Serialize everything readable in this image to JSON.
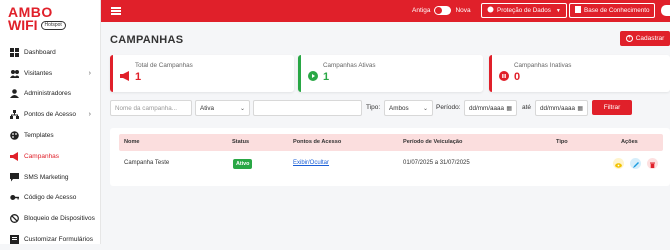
{
  "brand": {
    "line1": "AMBO",
    "line2": "WIFI",
    "badge": "Hotspot"
  },
  "sidebar": {
    "items": [
      {
        "label": "Dashboard",
        "icon": "grid-icon",
        "chevron": false,
        "active": false
      },
      {
        "label": "Visitantes",
        "icon": "users-icon",
        "chevron": true,
        "active": false
      },
      {
        "label": "Administradores",
        "icon": "user-icon",
        "chevron": false,
        "active": false
      },
      {
        "label": "Pontos de Acesso",
        "icon": "network-icon",
        "chevron": true,
        "active": false
      },
      {
        "label": "Templates",
        "icon": "palette-icon",
        "chevron": false,
        "active": false
      },
      {
        "label": "Campanhas",
        "icon": "megaphone-icon",
        "chevron": false,
        "active": true
      },
      {
        "label": "SMS Marketing",
        "icon": "sms-icon",
        "chevron": false,
        "active": false
      },
      {
        "label": "Código de Acesso",
        "icon": "key-icon",
        "chevron": false,
        "active": false
      },
      {
        "label": "Bloqueio de Dispositivos",
        "icon": "block-icon",
        "chevron": false,
        "active": false
      },
      {
        "label": "Customizar Formulários",
        "icon": "form-icon",
        "chevron": false,
        "active": false
      }
    ]
  },
  "topbar": {
    "toggle_left": "Antiga",
    "toggle_right": "Nova",
    "privacy_label": "Proteção de Dados",
    "knowledge_label": "Base de Conhecimento"
  },
  "page": {
    "title": "CAMPANHAS",
    "add_label": "Cadastrar"
  },
  "cards": [
    {
      "label": "Total de Campanhas",
      "value": "1",
      "color": "#e0202a"
    },
    {
      "label": "Campanhas Ativas",
      "value": "1",
      "color": "#29a745"
    },
    {
      "label": "Campanhas Inativas",
      "value": "0",
      "color": "#e0202a"
    }
  ],
  "filters": {
    "name_placeholder": "Nome da campanha...",
    "status_value": "Ativa",
    "tipo_label": "Tipo:",
    "tipo_value": "Ambos",
    "periodo_label": "Período:",
    "date_from": "dd/mm/aaaa",
    "ate_label": "até",
    "date_to": "dd/mm/aaaa",
    "filter_label": "Filtrar"
  },
  "table": {
    "headers": [
      "Nome",
      "Status",
      "Pontos de Acesso",
      "Período de Veiculação",
      "Tipo",
      "Ações"
    ],
    "rows": [
      {
        "nome": "Campanha Teste",
        "status": "Ativo",
        "pontos": "Exibir/Ocultar",
        "periodo": "01/07/2025 a 31/07/2025",
        "tipo": ""
      }
    ]
  },
  "colors": {
    "brand": "#e0202a",
    "success": "#29a745",
    "view": "#f2c200",
    "edit": "#1a9be0",
    "delete": "#e0202a"
  }
}
